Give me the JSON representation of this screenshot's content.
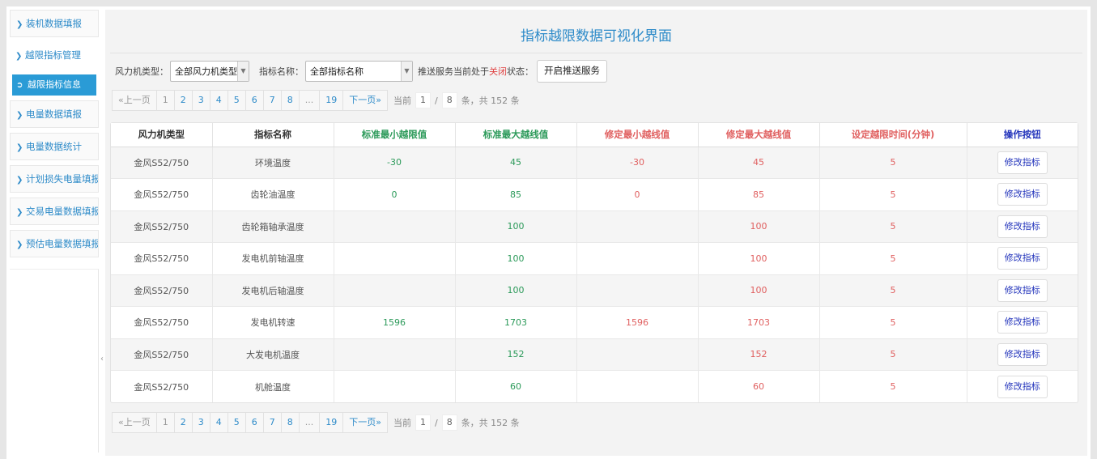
{
  "sidebar": {
    "items": [
      {
        "label": "装机数据填报"
      },
      {
        "label": "越限指标管理"
      },
      {
        "label": "越限指标信息"
      },
      {
        "label": "电量数据填报"
      },
      {
        "label": "电量数据统计"
      },
      {
        "label": "计划损失电量填报"
      },
      {
        "label": "交易电量数据填报"
      },
      {
        "label": "预估电量数据填报"
      }
    ]
  },
  "page_title": "指标越限数据可视化界面",
  "filters": {
    "turbine_type_label": "风力机类型：",
    "turbine_type_value": "全部风力机类型",
    "indicator_label": "指标名称：",
    "indicator_value": "全部指标名称",
    "push_prefix": "推送服务当前处于",
    "push_status": "关闭",
    "push_suffix": "状态：",
    "push_button": "开启推送服务"
  },
  "pager": {
    "prev": "«上一页",
    "pages": [
      "1",
      "2",
      "3",
      "4",
      "5",
      "6",
      "7",
      "8",
      "...",
      "19"
    ],
    "next": "下一页»",
    "current_prefix": "当前",
    "current": "1",
    "sep": "/",
    "total_pages": "8",
    "total_suffix": "条，共 152 条"
  },
  "table": {
    "headers": [
      "风力机类型",
      "指标名称",
      "标准最小越限值",
      "标准最大越线值",
      "修定最小越线值",
      "修定最大越线值",
      "设定越限时间(分钟)",
      "操作按钮"
    ],
    "header_colors": [
      "#333333",
      "#333333",
      "#2c9a5a",
      "#2c9a5a",
      "#e06060",
      "#e06060",
      "#e06060",
      "#2233bb"
    ],
    "action_label": "修改指标",
    "rows": [
      [
        "金风S52/750",
        "环境温度",
        "-30",
        "45",
        "-30",
        "45",
        "5"
      ],
      [
        "金风S52/750",
        "齿轮油温度",
        "0",
        "85",
        "0",
        "85",
        "5"
      ],
      [
        "金风S52/750",
        "齿轮箱轴承温度",
        "",
        "100",
        "",
        "100",
        "5"
      ],
      [
        "金风S52/750",
        "发电机前轴温度",
        "",
        "100",
        "",
        "100",
        "5"
      ],
      [
        "金风S52/750",
        "发电机后轴温度",
        "",
        "100",
        "",
        "100",
        "5"
      ],
      [
        "金风S52/750",
        "发电机转速",
        "1596",
        "1703",
        "1596",
        "1703",
        "5"
      ],
      [
        "金风S52/750",
        "大发电机温度",
        "",
        "152",
        "",
        "152",
        "5"
      ],
      [
        "金风S52/750",
        "机舱温度",
        "",
        "60",
        "",
        "60",
        "5"
      ]
    ]
  }
}
